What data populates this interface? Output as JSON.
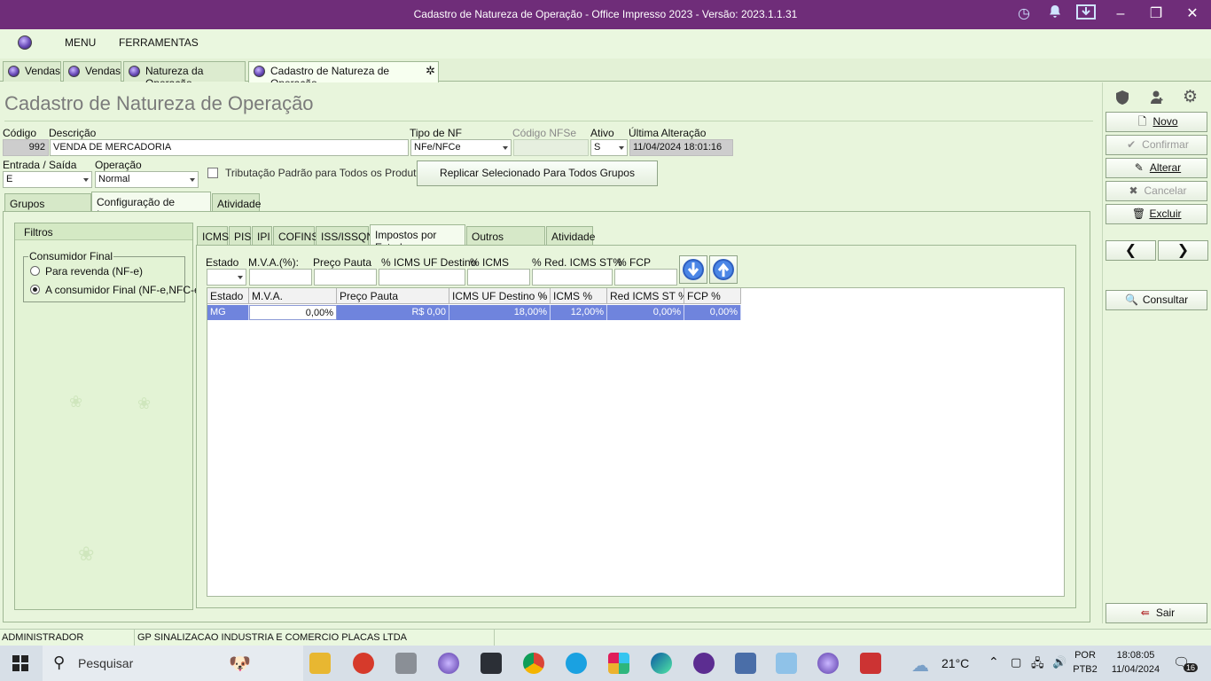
{
  "window": {
    "title": "Cadastro de Natureza de Operação - Office Impresso 2023 - Versão: 2023.1.1.31"
  },
  "menu": {
    "items": [
      "MENU",
      "FERRAMENTAS"
    ]
  },
  "doc_tabs": [
    "Vendas",
    "Vendas",
    "Natureza da Operação",
    "Cadastro de Natureza de Operação"
  ],
  "page_title": "Cadastro de Natureza de Operação",
  "form": {
    "codigo_label": "Código",
    "codigo": "992",
    "descricao_label": "Descrição",
    "descricao": "VENDA DE MERCADORIA",
    "tipo_nf_label": "Tipo de NF",
    "tipo_nf": "NFe/NFCe",
    "codigo_nfse_label": "Código NFSe",
    "codigo_nfse": "",
    "ativo_label": "Ativo",
    "ativo": "S",
    "ultima_alteracao_label": "Última Alteração",
    "ultima_alteracao": "11/04/2024 18:01:16",
    "entrada_saida_label": "Entrada / Saída",
    "entrada_saida": "E",
    "operacao_label": "Operação",
    "operacao": "Normal",
    "tributacao_label": "Tributação Padrão para Todos os Produtos",
    "replicar_button": "Replicar Selecionado Para Todos Grupos"
  },
  "main_tabs": [
    "Grupos Vinculados",
    "Configuração de Impostos",
    "Atividade"
  ],
  "filtros": {
    "title": "Filtros",
    "group_label": "Consumidor Final",
    "options": [
      "Para revenda (NF-e)",
      "A consumidor Final (NF-e,NFC-e)"
    ],
    "selected": "A consumidor Final (NF-e,NFC-e)"
  },
  "tax_tabs": [
    "ICMS",
    "PIS",
    "IPI",
    "COFINS",
    "ISS/ISSQN",
    "Impostos por Estado",
    "Outros Impostos",
    "Atividade"
  ],
  "estado_filters": {
    "labels": [
      "Estado",
      "M.V.A.(%):",
      "Preço Pauta",
      "% ICMS UF Destino",
      "% ICMS",
      "% Red. ICMS ST%",
      "% FCP"
    ]
  },
  "grid": {
    "columns": [
      "Estado",
      "M.V.A.",
      "Preço Pauta",
      "ICMS UF Destino %",
      "ICMS %",
      "Red ICMS ST %",
      "FCP %"
    ],
    "rows": [
      [
        "MG",
        "0,00%",
        "R$ 0,00",
        "18,00%",
        "12,00%",
        "0,00%",
        "0,00%"
      ]
    ]
  },
  "actions": {
    "novo": "Novo",
    "confirmar": "Confirmar",
    "alterar": "Alterar",
    "cancelar": "Cancelar",
    "excluir": "Excluir",
    "consultar": "Consultar",
    "sair": "Sair"
  },
  "status": {
    "user": "ADMINISTRADOR",
    "company": "GP SINALIZACAO INDUSTRIA E COMERCIO PLACAS LTDA"
  },
  "taskbar": {
    "search_placeholder": "Pesquisar",
    "weather": "21°C",
    "lang_1": "POR",
    "lang_2": "PTB2",
    "time": "18:08:05",
    "date": "11/04/2024",
    "notifications": "16"
  },
  "colors": {
    "titlebar": "#6f2d79",
    "background": "#e8f5dc",
    "selected_row": "#6f84dd"
  }
}
